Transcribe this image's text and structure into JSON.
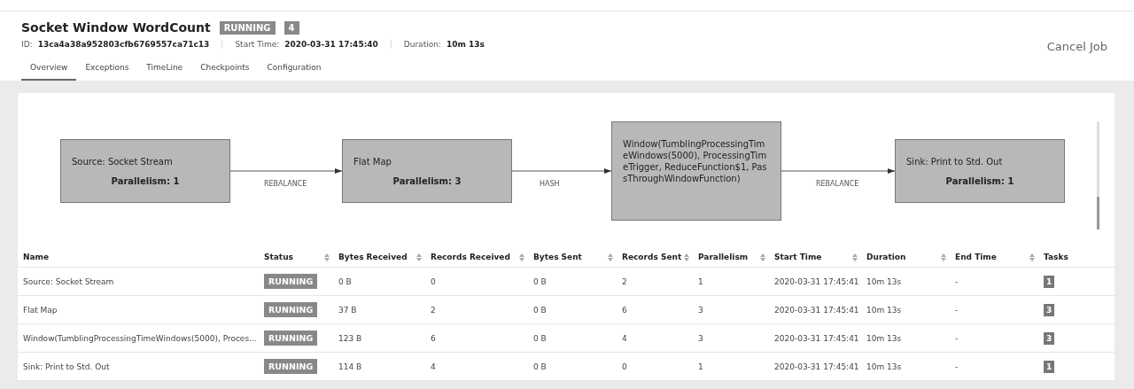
{
  "job": {
    "title": "Socket Window WordCount",
    "status": "RUNNING",
    "task_count": "4",
    "id_label": "ID:",
    "id": "13ca4a38a952803cfb6769557ca71c13",
    "start_label": "Start Time:",
    "start": "2020-03-31 17:45:40",
    "duration_label": "Duration:",
    "duration": "10m 13s",
    "cancel": "Cancel Job"
  },
  "tabs": [
    {
      "label": "Overview",
      "selected": true
    },
    {
      "label": "Exceptions",
      "selected": false
    },
    {
      "label": "TimeLine",
      "selected": false
    },
    {
      "label": "Checkpoints",
      "selected": false
    },
    {
      "label": "Configuration",
      "selected": false
    }
  ],
  "graph": {
    "nodes": [
      {
        "name": "Source: Socket Stream",
        "parallelism": "Parallelism: 1"
      },
      {
        "name": "Flat Map",
        "parallelism": "Parallelism: 3"
      },
      {
        "name": "Window(TumblingProcessingTimeWindows(5000), ProcessingTimeTrigger, ReduceFunction$1, PassThroughWindowFunction)"
      },
      {
        "name": "Sink: Print to Std. Out",
        "parallelism": "Parallelism: 1"
      }
    ],
    "edges": [
      "REBALANCE",
      "HASH",
      "REBALANCE"
    ],
    "zoom": {
      "level": 0.3
    }
  },
  "table": {
    "columns": [
      "Name",
      "Status",
      "Bytes Received",
      "Records Received",
      "Bytes Sent",
      "Records Sent",
      "Parallelism",
      "Start Time",
      "Duration",
      "End Time",
      "Tasks"
    ],
    "rows": [
      [
        "Source: Socket Stream",
        "RUNNING",
        "0 B",
        "0",
        "0 B",
        "2",
        "1",
        "2020-03-31 17:45:41",
        "10m 13s",
        "-",
        "1"
      ],
      [
        "Flat Map",
        "RUNNING",
        "37 B",
        "2",
        "0 B",
        "6",
        "3",
        "2020-03-31 17:45:41",
        "10m 13s",
        "-",
        "3"
      ],
      [
        "Window(TumblingProcessingTimeWindows(5000), Proces...",
        "RUNNING",
        "123 B",
        "6",
        "0 B",
        "4",
        "3",
        "2020-03-31 17:45:41",
        "10m 13s",
        "-",
        "3"
      ],
      [
        "Sink: Print to Std. Out",
        "RUNNING",
        "114 B",
        "4",
        "0 B",
        "0",
        "1",
        "2020-03-31 17:45:41",
        "10m 13s",
        "-",
        "1"
      ]
    ]
  }
}
